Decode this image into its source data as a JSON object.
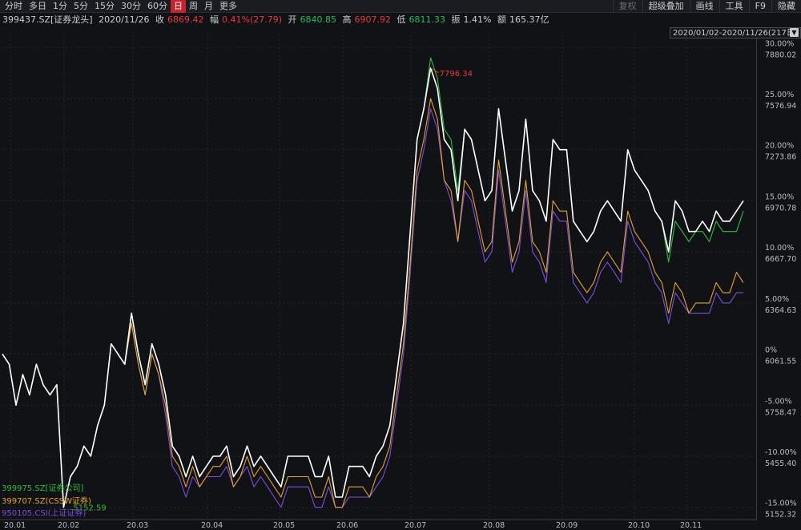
{
  "toolbar": {
    "periods": [
      "分时",
      "多日",
      "1分",
      "5分",
      "15分",
      "30分",
      "60分",
      "日",
      "周",
      "月",
      "更多"
    ],
    "active_period": "日",
    "tools": [
      {
        "label": "复权",
        "dim": true
      },
      {
        "label": "超级叠加",
        "dim": false
      },
      {
        "label": "画线",
        "dim": false
      },
      {
        "label": "工具",
        "dim": false
      },
      {
        "label": "F9",
        "dim": false
      },
      {
        "label": "隐藏",
        "dim": false
      }
    ]
  },
  "info": {
    "code": "399437.SZ[证券龙头]",
    "date": "2020/11/26",
    "close_label": "收",
    "close": "6869.42",
    "change_label": "幅",
    "change": "0.41%(27.79)",
    "open_label": "开",
    "open": "6840.85",
    "high_label": "高",
    "high": "6907.92",
    "low_label": "低",
    "low": "6811.33",
    "amplitude_label": "振",
    "amplitude": "1.41%",
    "amount_label": "额",
    "amount": "165.37亿"
  },
  "range_label": "2020/01/02-2020/11/26(217日)",
  "colors": {
    "main": "#ffffff",
    "s1": "#2fbf3a",
    "s2": "#e6a42a",
    "s3": "#7a4fe0",
    "max_label": "#e8393c",
    "min_label": "#2fbf3a"
  },
  "chart_data": {
    "type": "line",
    "x_ticks": [
      "20.01",
      "20.02",
      "20.03",
      "20.04",
      "20.05",
      "20.06",
      "20.07",
      "20.08",
      "20.09",
      "20.10",
      "20.11"
    ],
    "y_ticks": [
      {
        "pct": 30,
        "label": "30.00%",
        "price": "7880.02"
      },
      {
        "pct": 25,
        "label": "25.00%",
        "price": "7576.94"
      },
      {
        "pct": 20,
        "label": "20.00%",
        "price": "7273.86"
      },
      {
        "pct": 15,
        "label": "15.00%",
        "price": "6970.78"
      },
      {
        "pct": 10,
        "label": "10.00%",
        "price": "6667.70"
      },
      {
        "pct": 5,
        "label": "5.00%",
        "price": "6364.63"
      },
      {
        "pct": 0,
        "label": "0%",
        "price": "6061.55"
      },
      {
        "pct": -5,
        "label": "-5.00%",
        "price": "5758.47"
      },
      {
        "pct": -10,
        "label": "-10.00%",
        "price": "5455.40"
      },
      {
        "pct": -15,
        "label": "-15.00%",
        "price": "5152.32"
      }
    ],
    "ylim": [
      -16.2,
      31.2
    ],
    "max_label": "7796.34",
    "min_label": "5152.59",
    "series": [
      {
        "name": "399437.SZ[证券龙头]",
        "key": "main",
        "values": [
          0,
          -1,
          -5,
          -2,
          -4,
          -1,
          -3,
          -4,
          -3,
          -15,
          -12,
          -11,
          -9,
          -10,
          -7,
          -5,
          1,
          0,
          -1,
          4,
          0,
          -3,
          1,
          -1,
          -4,
          -9,
          -10,
          -12,
          -10,
          -12,
          -11,
          -10,
          -10,
          -9,
          -12,
          -11,
          -9,
          -11,
          -10,
          -11,
          -12,
          -13,
          -10,
          -10,
          -10,
          -10,
          -12,
          -12,
          -10,
          -14,
          -14,
          -11,
          -11,
          -11,
          -12,
          -10,
          -9,
          -7,
          -2,
          3,
          12,
          21,
          24,
          28,
          26,
          21,
          20,
          15,
          22,
          21,
          18,
          15,
          16,
          24,
          19,
          14,
          16,
          23,
          16,
          15,
          13,
          21,
          20,
          20,
          13,
          12,
          11,
          12,
          14,
          15,
          14,
          13,
          20,
          18,
          17,
          16,
          14,
          13,
          10,
          15,
          14,
          12,
          12,
          13,
          12,
          14,
          13,
          13,
          14,
          15
        ]
      },
      {
        "name": "399975.SZ[证券公司]",
        "key": "s1",
        "values": [
          0,
          -1,
          -5,
          -2,
          -4,
          -1,
          -3,
          -4,
          -3,
          -15,
          -12,
          -11,
          -9,
          -10,
          -7,
          -5,
          1,
          0,
          -1,
          4,
          0,
          -3,
          1,
          -1,
          -4,
          -9,
          -10,
          -12,
          -10,
          -12,
          -11,
          -10,
          -10,
          -9,
          -12,
          -11,
          -9,
          -11,
          -10,
          -11,
          -12,
          -13,
          -10,
          -10,
          -10,
          -10,
          -12,
          -12,
          -10,
          -14,
          -14,
          -11,
          -11,
          -11,
          -12,
          -10,
          -9,
          -7,
          -2,
          3,
          12,
          21,
          24,
          29,
          27,
          22,
          21,
          16,
          22,
          21,
          18,
          15,
          16,
          24,
          19,
          14,
          16,
          23,
          16,
          15,
          13,
          21,
          20,
          20,
          13,
          12,
          11,
          12,
          14,
          15,
          14,
          13,
          20,
          18,
          17,
          16,
          14,
          13,
          9,
          13,
          12,
          11,
          12,
          12,
          11,
          13,
          12,
          12,
          12,
          14
        ]
      },
      {
        "name": "399707.SZ(CSSW证券)",
        "key": "s2",
        "values": [
          0,
          -1,
          -5,
          -2,
          -4,
          -1,
          -3,
          -4,
          -3,
          -15,
          -12,
          -11,
          -9,
          -10,
          -7,
          -5,
          1,
          0,
          -1,
          3,
          -1,
          -4,
          0,
          -2,
          -5,
          -10,
          -11,
          -13,
          -11,
          -13,
          -12,
          -11,
          -11,
          -10,
          -13,
          -12,
          -10,
          -12,
          -11,
          -12,
          -13,
          -14,
          -12,
          -12,
          -12,
          -12,
          -14,
          -14,
          -12,
          -15,
          -15,
          -13,
          -13,
          -13,
          -14,
          -12,
          -11,
          -9,
          -4,
          1,
          9,
          18,
          21,
          25,
          23,
          17,
          16,
          11,
          17,
          16,
          13,
          10,
          11,
          19,
          14,
          9,
          11,
          17,
          11,
          10,
          8,
          15,
          14,
          14,
          8,
          7,
          6,
          7,
          9,
          10,
          9,
          8,
          14,
          12,
          11,
          10,
          8,
          7,
          4,
          7,
          6,
          4,
          5,
          5,
          5,
          7,
          6,
          6,
          8,
          7
        ]
      },
      {
        "name": "950105.CSI(上证证券)",
        "key": "s3",
        "values": [
          0,
          -1,
          -5,
          -2,
          -4,
          -1,
          -3,
          -4,
          -3,
          -15,
          -12,
          -11,
          -9,
          -10,
          -7,
          -5,
          1,
          0,
          -1,
          3,
          -1,
          -4,
          0,
          -2,
          -6,
          -11,
          -12,
          -14,
          -12,
          -13,
          -12,
          -12,
          -12,
          -11,
          -13,
          -12,
          -11,
          -13,
          -12,
          -13,
          -14,
          -15,
          -13,
          -13,
          -13,
          -13,
          -15,
          -15,
          -13,
          -15,
          -15,
          -14,
          -14,
          -14,
          -14,
          -13,
          -12,
          -10,
          -5,
          0,
          8,
          17,
          20,
          24,
          22,
          17,
          15,
          11,
          16,
          15,
          12,
          9,
          10,
          18,
          13,
          8,
          10,
          16,
          10,
          9,
          7,
          14,
          13,
          13,
          7,
          6,
          5,
          6,
          8,
          9,
          8,
          7,
          13,
          11,
          10,
          9,
          7,
          6,
          3,
          6,
          5,
          4,
          4,
          4,
          4,
          6,
          5,
          5,
          6,
          6
        ]
      }
    ]
  }
}
